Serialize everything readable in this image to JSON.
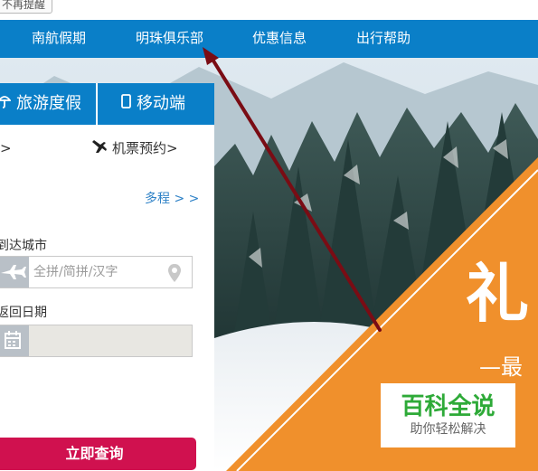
{
  "reminder_button": "不再提醒",
  "nav": {
    "items": [
      "南航假期",
      "明珠俱乐部",
      "优惠信息",
      "出行帮助"
    ]
  },
  "panel": {
    "tabs": [
      "旅游度假",
      "移动端"
    ],
    "left_link_fragment": ">",
    "ticket_booking": "机票预约>",
    "multi_trip": "多程 > >",
    "arrival_city_label": "到达城市",
    "arrival_city_placeholder": "全拼/简拼/汉字",
    "return_date_label": "返回日期",
    "search_button": "立即查询"
  },
  "promo": {
    "headline": "礼",
    "subline": "—最"
  },
  "watermark": {
    "title": "百科全说",
    "subtitle": "助你轻松解决"
  },
  "colors": {
    "nav_blue": "#0a7fc8",
    "search_pink": "#d0114f",
    "promo_orange": "#f0902c",
    "arrow_red": "#7a0c14",
    "watermark_green": "#2eaa38"
  },
  "icons": [
    "umbrella-icon",
    "mobile-phone-icon",
    "plane-icon",
    "airplane-icon",
    "location-pin-icon",
    "calendar-icon"
  ]
}
